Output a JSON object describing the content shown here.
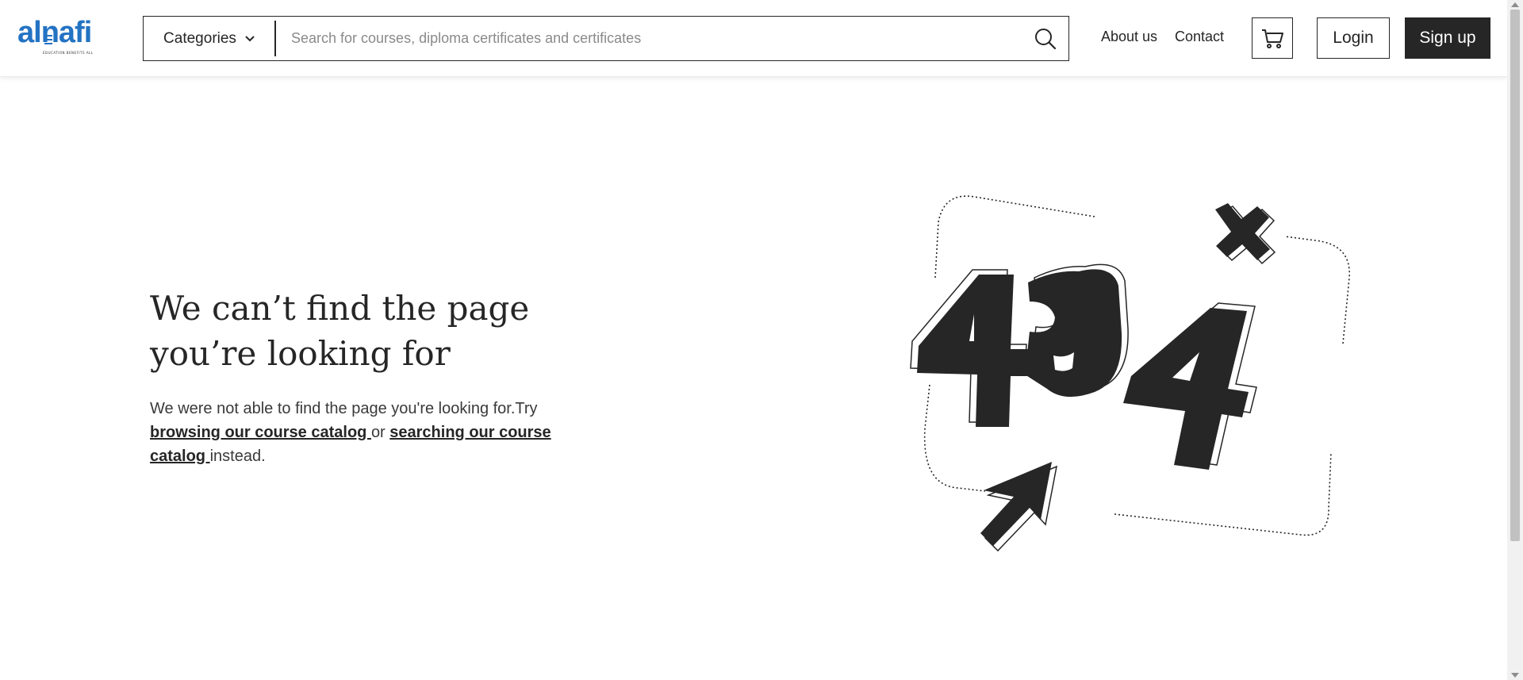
{
  "brand": {
    "logo_text": "alnafi",
    "tagline": "EDUCATION BENEFITS ALL",
    "accent_color": "#2373c3"
  },
  "header": {
    "categories_label": "Categories",
    "search_placeholder": "Search for courses, diploma certificates and certificates",
    "search_value": "",
    "nav": {
      "about_label": "About us",
      "contact_label": "Contact"
    },
    "login_label": "Login",
    "signup_label": "Sign up"
  },
  "error_page": {
    "title": "We can’t find the page you’re looking for",
    "desc_prefix": "We were not able to find the page you're looking for.Try ",
    "catalog_link": "browsing our course catalog ",
    "desc_middle": "or ",
    "search_link": "searching our course catalog ",
    "desc_suffix": "instead.",
    "illustration_text": "404"
  },
  "icons": {
    "categories": "chevron-down-icon",
    "search": "search-icon",
    "cart": "shopping-cart-icon",
    "illustration_cross": "x-mark-icon",
    "illustration_pointer": "cursor-arrow-icon"
  },
  "colors": {
    "text": "#262626",
    "primary_button_bg": "#262626",
    "primary_button_text": "#ffffff",
    "background": "#ffffff"
  }
}
